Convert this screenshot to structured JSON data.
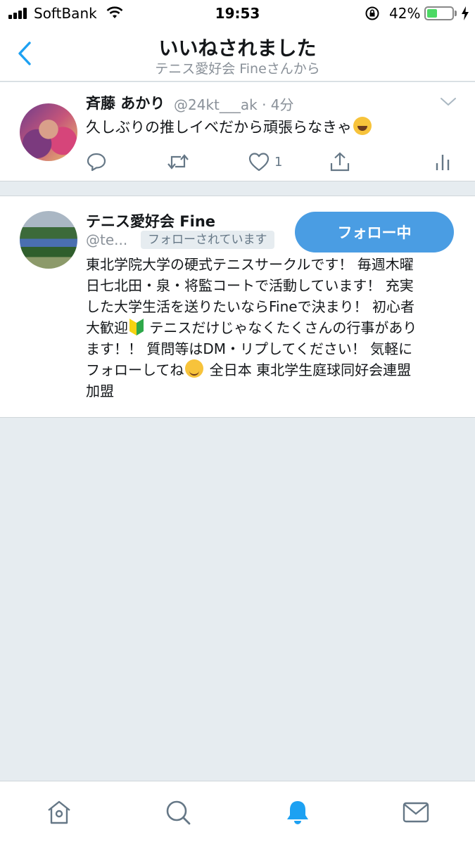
{
  "status_bar": {
    "carrier": "SoftBank",
    "time": "19:53",
    "battery_percent": "42%",
    "battery_level": 0.42
  },
  "nav": {
    "title": "いいねされました",
    "subtitle": "テニス愛好会 Fineさんから"
  },
  "tweet": {
    "author_name": "斉藤 あかり",
    "meta": "@24kt___ak · 4分",
    "text": "久しぶりの推しイベだから頑張らなきゃ",
    "like_count": "1"
  },
  "user_card": {
    "name": "テニス愛好会 Fine",
    "handle": "@te...",
    "follows_you_badge": "フォローされています",
    "follow_button": "フォロー中",
    "bio_lines": [
      "東北学院大学の硬式テニスサークルです！ 毎週木曜",
      "日七北田・泉・将監コートで活動しています！ 充実",
      "した大学生活を送りたいならFineで決まり！ 初心者",
      "大歓迎",
      "テニスだけじゃなくたくさんの行事があり",
      "ます！！ 質問等はDM・リプしてください！ 気軽に",
      "フォローしてね",
      "全日本 東北学生庭球同好会連盟",
      "加盟"
    ]
  },
  "colors": {
    "accent": "#1da1f2",
    "follow_button": "#4a9de3",
    "secondary_text": "#8a9199",
    "background": "#e6ecf0"
  },
  "tabs": {
    "home": "home-icon",
    "search": "search-icon",
    "notifications": "bell-icon",
    "messages": "mail-icon",
    "active": "notifications"
  }
}
